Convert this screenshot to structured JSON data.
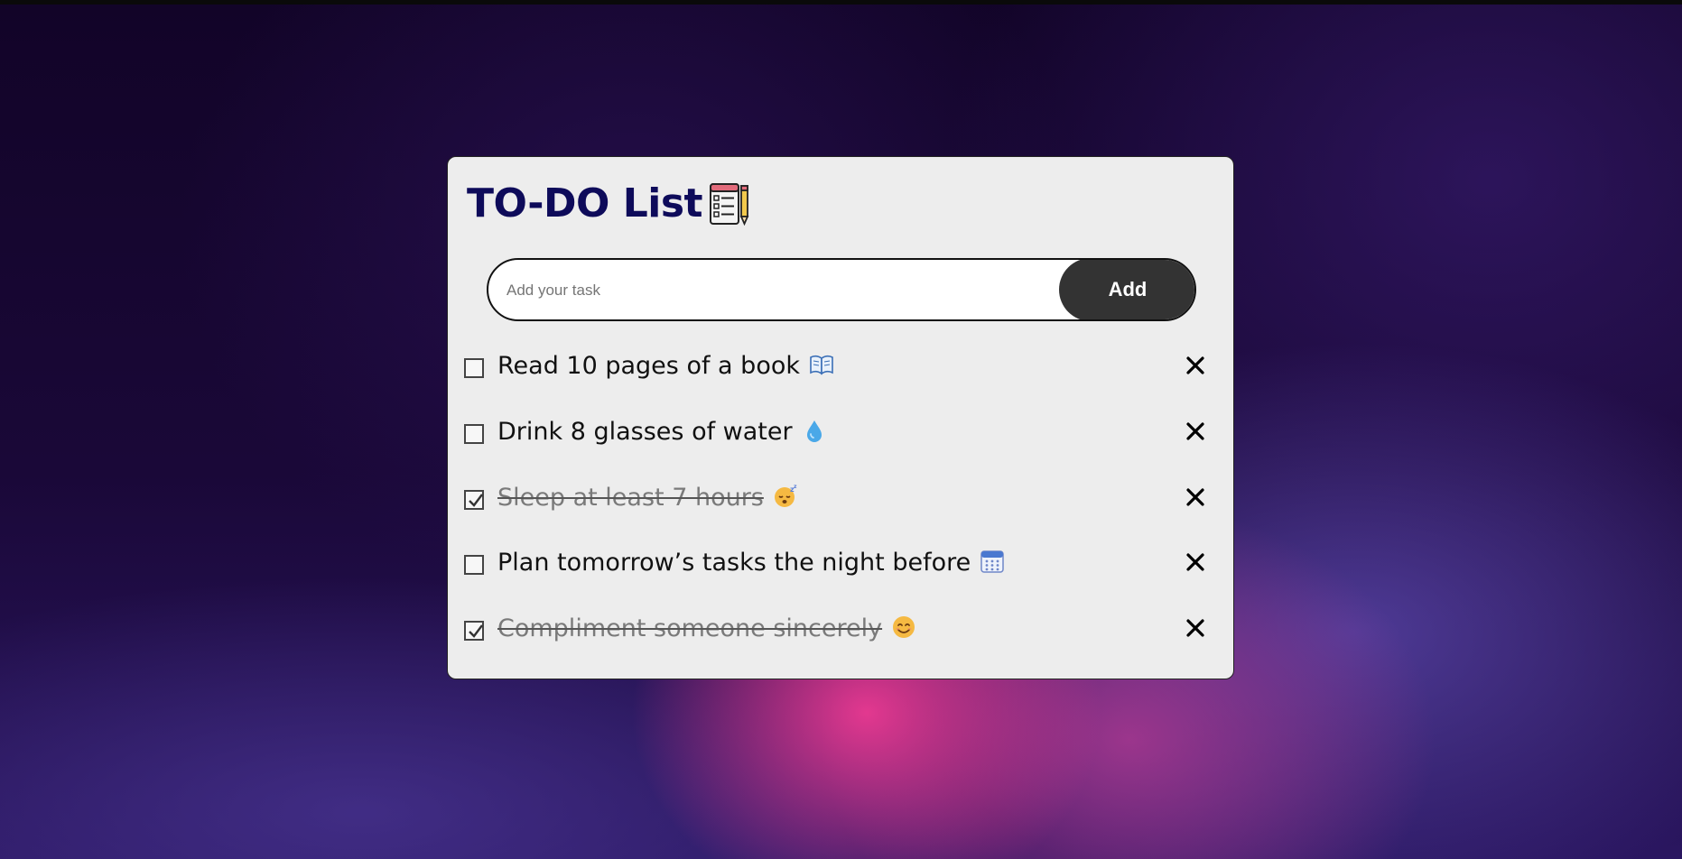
{
  "app": {
    "title": "TO-DO List",
    "title_icon": "checklist-pencil-icon"
  },
  "add_form": {
    "placeholder": "Add your task",
    "value": "",
    "button_label": "Add"
  },
  "tasks": [
    {
      "text": "Read 10 pages of a book",
      "emoji": "open-book-icon",
      "checked": false
    },
    {
      "text": "Drink 8 glasses of water",
      "emoji": "droplet-icon",
      "checked": false
    },
    {
      "text": "Sleep at least 7 hours",
      "emoji": "sleeping-face-icon",
      "checked": true
    },
    {
      "text": "Plan tomorrow’s tasks the night before",
      "emoji": "calendar-icon",
      "checked": false
    },
    {
      "text": "Compliment someone sincerely",
      "emoji": "smiling-face-icon",
      "checked": true
    }
  ],
  "colors": {
    "title": "#0e0b5a",
    "card": "#ededed",
    "add_button": "#333333",
    "done_text": "#7a7a7a"
  }
}
